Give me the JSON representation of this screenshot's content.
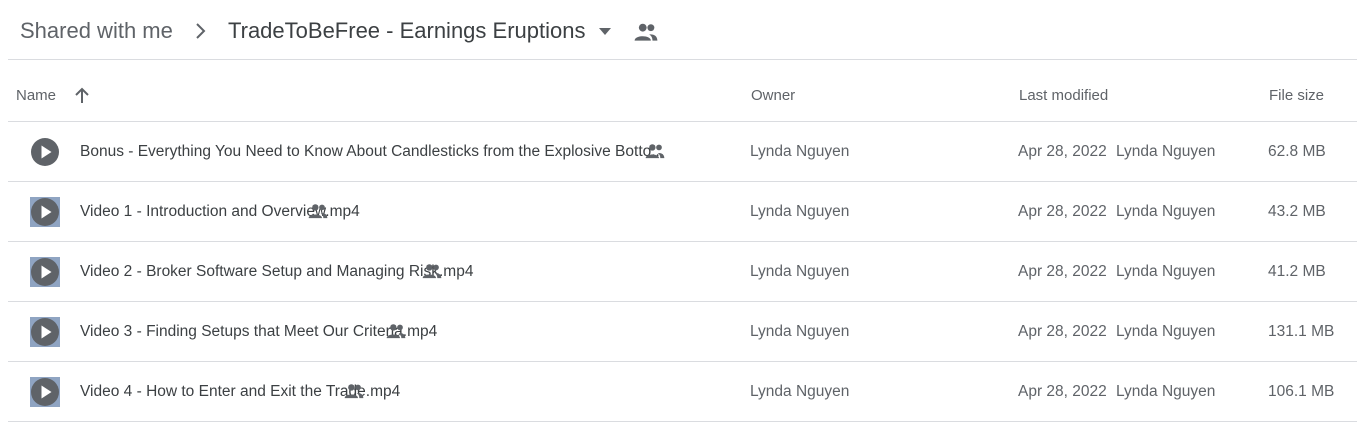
{
  "breadcrumb": {
    "root": "Shared with me",
    "current": "TradeToBeFree - Earnings Eruptions"
  },
  "columns": {
    "name": "Name",
    "owner": "Owner",
    "last_modified": "Last modified",
    "file_size": "File size"
  },
  "files": [
    {
      "name": "Bonus - Everything You Need to Know About Candlesticks from the Explosive Botto...",
      "owner": "Lynda Nguyen",
      "date": "Apr 28, 2022",
      "modifier": "Lynda Nguyen",
      "size": "62.8 MB",
      "icon": "video-play-icon"
    },
    {
      "name": "Video 1 - Introduction and Overview.mp4",
      "owner": "Lynda Nguyen",
      "date": "Apr 28, 2022",
      "modifier": "Lynda Nguyen",
      "size": "43.2 MB",
      "icon": "video-thumbnail-icon"
    },
    {
      "name": "Video 2 - Broker Software Setup and Managing Risk.mp4",
      "owner": "Lynda Nguyen",
      "date": "Apr 28, 2022",
      "modifier": "Lynda Nguyen",
      "size": "41.2 MB",
      "icon": "video-thumbnail-icon"
    },
    {
      "name": "Video 3 - Finding Setups that Meet Our Criteria.mp4",
      "owner": "Lynda Nguyen",
      "date": "Apr 28, 2022",
      "modifier": "Lynda Nguyen",
      "size": "131.1 MB",
      "icon": "video-thumbnail-icon"
    },
    {
      "name": "Video 4 - How to Enter and Exit the Trade.mp4",
      "owner": "Lynda Nguyen",
      "date": "Apr 28, 2022",
      "modifier": "Lynda Nguyen",
      "size": "106.1 MB",
      "icon": "video-thumbnail-icon"
    }
  ],
  "colors": {
    "text_primary": "#3c4043",
    "text_secondary": "#5f6368",
    "divider": "#dadce0"
  }
}
